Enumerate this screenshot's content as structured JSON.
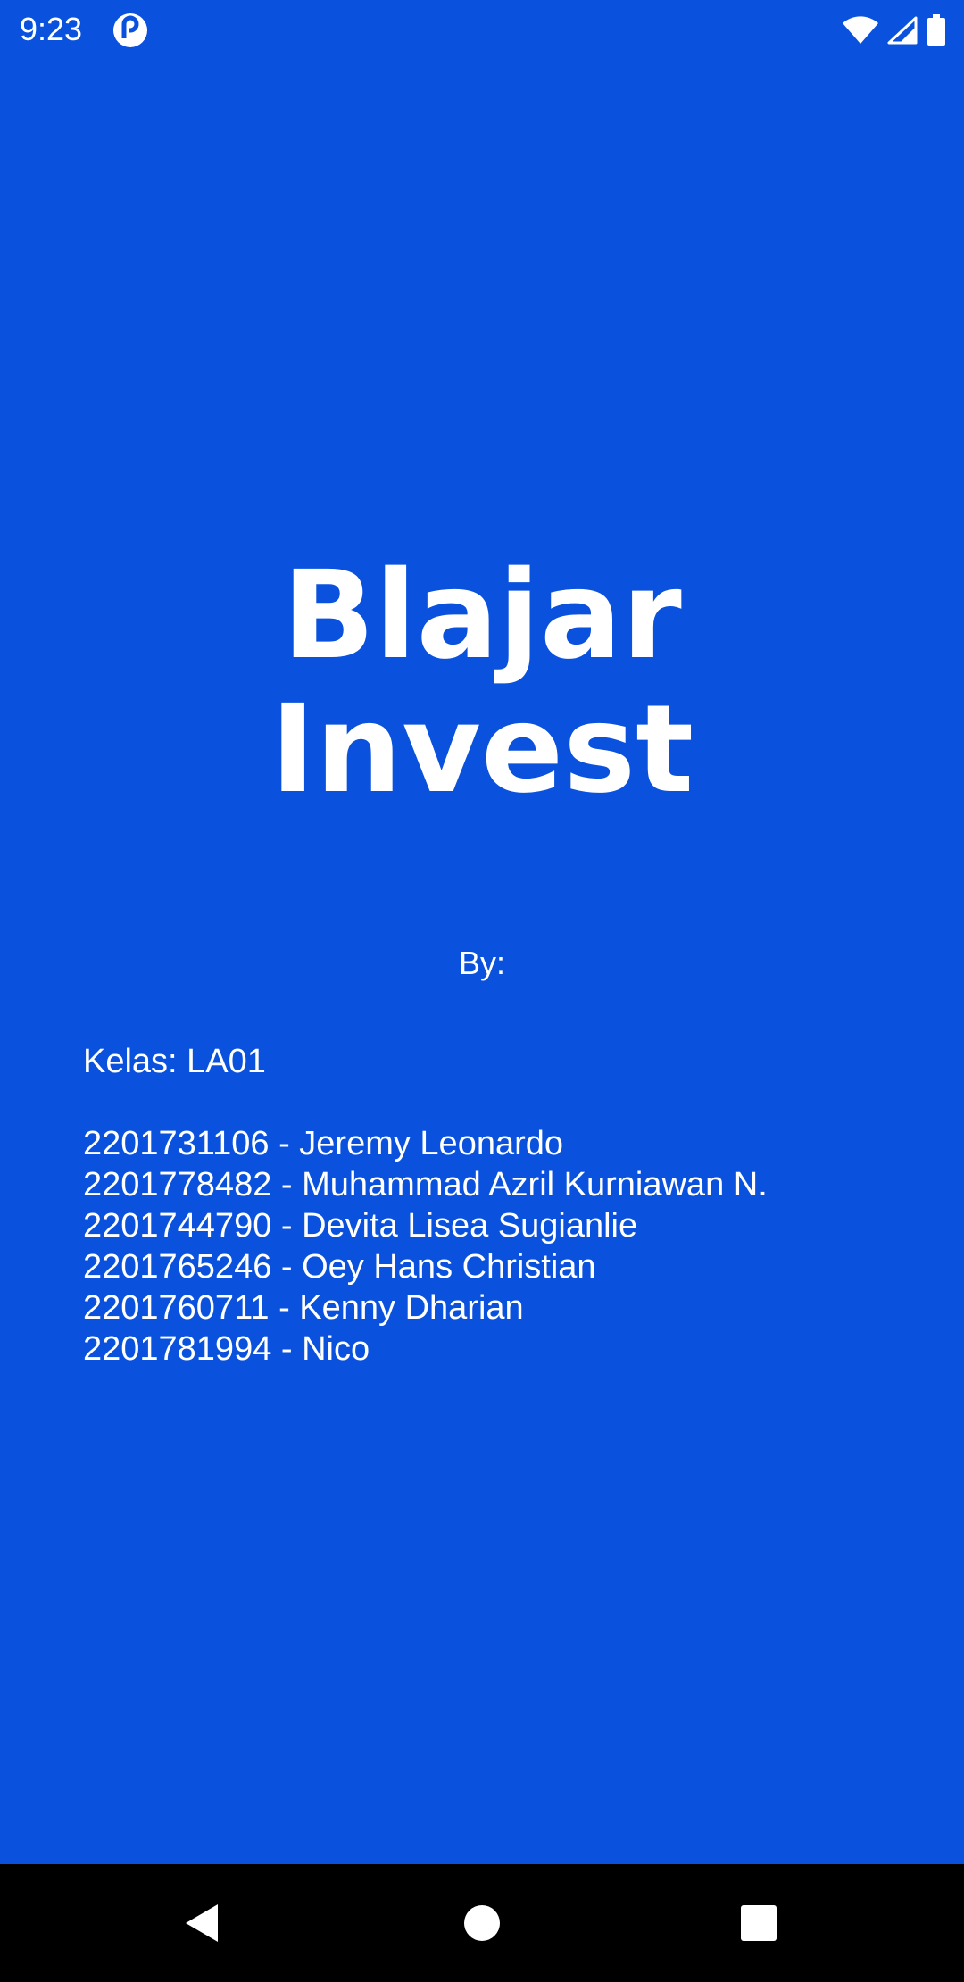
{
  "status_bar": {
    "time": "9:23",
    "app_icon": "pocket-casts-icon",
    "icons": [
      "wifi-icon",
      "cell-signal-icon",
      "battery-icon"
    ]
  },
  "title": {
    "line1": "Blajar",
    "line2": "Invest"
  },
  "by_label": "By:",
  "credits": {
    "class_line": "Kelas: LA01",
    "members": [
      "2201731106 - Jeremy Leonardo",
      "2201778482 - Muhammad Azril Kurniawan N.",
      "2201744790 - Devita Lisea Sugianlie",
      "2201765246 - Oey Hans Christian",
      "2201760711 - Kenny Dharian",
      "2201781994 - Nico"
    ]
  },
  "nav_bar": {
    "buttons": [
      "back-icon",
      "home-icon",
      "recents-icon"
    ]
  },
  "colors": {
    "background": "#0a52dd",
    "text": "#ffffff",
    "nav_background": "#000000"
  }
}
